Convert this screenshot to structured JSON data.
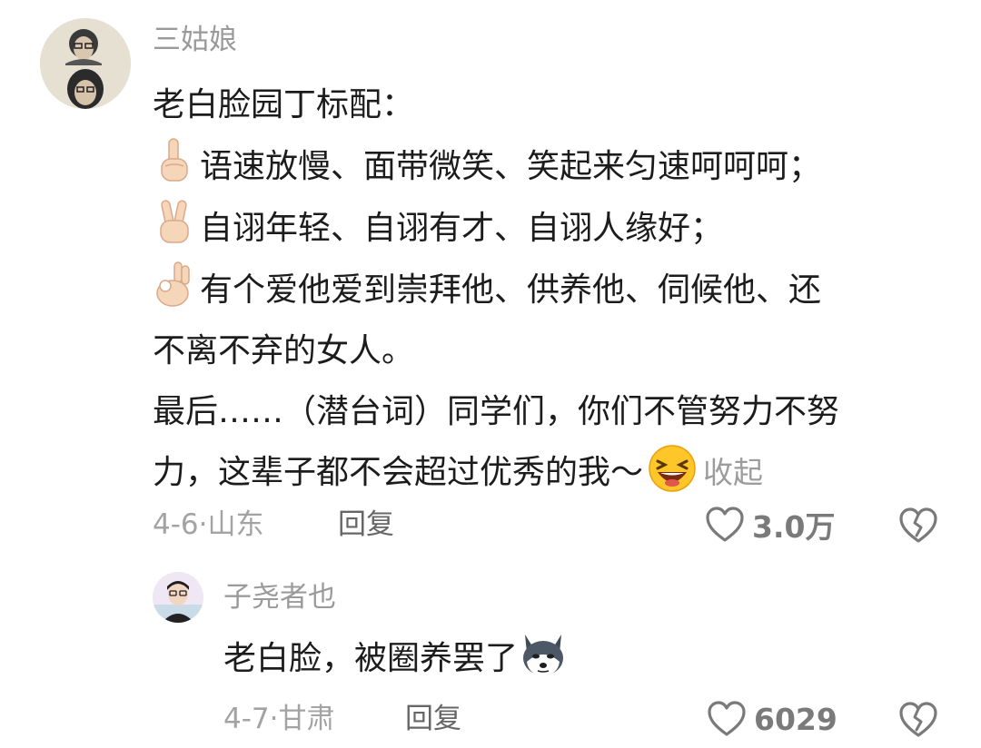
{
  "main_comment": {
    "username": "三姑娘",
    "body": {
      "title": "老白脸园丁标配：",
      "item1": "语速放慢、面带微笑、笑起来匀速呵呵呵；",
      "item2": "自诩年轻、自诩有才、自诩人缘好；",
      "item3_line1": "有个爱他爱到崇拜他、供养他、伺候他、还",
      "item3_line2": "不离不弃的女人。",
      "ending_line1": "最后……（潜台词）同学们，你们不管努力不努",
      "ending_line2": "力，这辈子都不会超过优秀的我～",
      "collapse_label": "收起",
      "emojis": [
        "index-finger-up-icon",
        "victory-hand-icon",
        "ok-hand-icon",
        "laughing-face-icon"
      ]
    },
    "date_location": "4-6·山东",
    "reply_label": "回复",
    "like_count": "3.0万"
  },
  "reply_comment": {
    "username": "子尧者也",
    "body": "老白脸，被圈养罢了",
    "emoji": "husky-face-icon",
    "date_location": "4-7·甘肃",
    "reply_label": "回复",
    "like_count": "6029"
  }
}
